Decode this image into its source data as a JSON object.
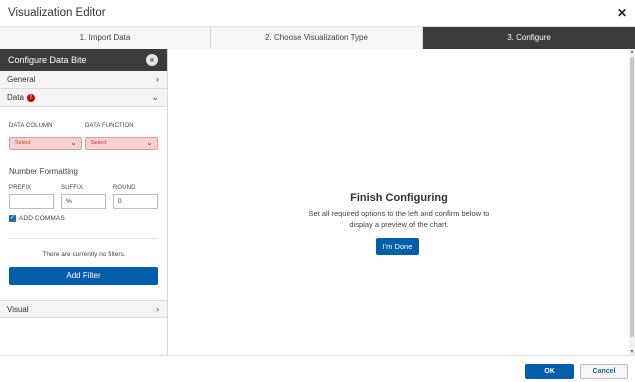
{
  "window": {
    "title": "Visualization Editor",
    "close_icon": "✕"
  },
  "steps": [
    {
      "label": "1. Import Data"
    },
    {
      "label": "2. Choose Visualization Type"
    },
    {
      "label": "3. Configure",
      "active": true
    }
  ],
  "sidebar": {
    "header": "Configure Data Bite",
    "collapse_glyph": "«",
    "sections": {
      "general": "General",
      "data": "Data",
      "visual": "Visual"
    },
    "data_panel": {
      "data_column_label": "DATA COLUMN",
      "data_function_label": "DATA FUNCTION",
      "data_column_value": "Select",
      "data_function_value": "Select",
      "number_formatting_title": "Number Formatting",
      "prefix_label": "PREFIX",
      "suffix_label": "SUFFIX",
      "round_label": "ROUND",
      "prefix_value": "",
      "suffix_value": "%",
      "round_value": "0",
      "add_commas_label": "ADD COMMAS",
      "add_commas_checked": true,
      "no_filters_text": "There are currently no filters.",
      "add_filter_label": "Add Filter"
    }
  },
  "main": {
    "title": "Finish Configuring",
    "description": "Set all required options to the left and confirm below to display a preview of the chart.",
    "done_label": "I'm Done"
  },
  "footer": {
    "ok_label": "OK",
    "cancel_label": "Cancel"
  },
  "colors": {
    "primary": "#005eaa",
    "dark": "#3c3c3c",
    "error": "#cc0000",
    "select_bg": "#f9d1d1"
  }
}
